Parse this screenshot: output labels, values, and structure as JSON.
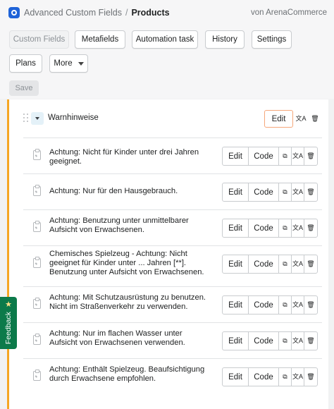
{
  "header": {
    "app_title": "Advanced Custom Fields",
    "separator": "/",
    "page_title": "Products",
    "vendor": "von ArenaCommerce"
  },
  "toolbar": {
    "row1": [
      "Custom Fields",
      "Metafields",
      "Automation task",
      "History",
      "Settings"
    ],
    "plans_label": "Plans",
    "more_label": "More",
    "save_label": "Save"
  },
  "group": {
    "title": "Warnhinweise",
    "edit_label": "Edit"
  },
  "item_actions": {
    "edit": "Edit",
    "code": "Code"
  },
  "items": [
    {
      "text": "Achtung: Nicht für Kinder unter drei Jahren geeignet."
    },
    {
      "text": "Achtung: Nur für den Hausgebrauch."
    },
    {
      "text": "Achtung: Benutzung unter unmittelbarer Aufsicht von Erwachsenen."
    },
    {
      "text": "Chemisches Spielzeug - Achtung: Nicht geeignet für Kinder unter ... Jahren [**]. Benutzung unter Aufsicht von Erwachsenen."
    },
    {
      "text": "Achtung: Mit Schutzausrüstung zu benutzen. Nicht im Straßenverkehr zu verwenden."
    },
    {
      "text": "Achtung: Nur im flachen Wasser unter Aufsicht von Erwachsenen verwenden."
    },
    {
      "text": "Achtung: Enthält Spielzeug. Beaufsichtigung durch Erwachsene empfohlen."
    }
  ],
  "feedback": {
    "label": "Feedback",
    "icon": "star-icon"
  },
  "colors": {
    "accent_border": "#f5a623",
    "feedback_bg": "#0c7a4a",
    "logo_bg": "#1f63d8"
  }
}
